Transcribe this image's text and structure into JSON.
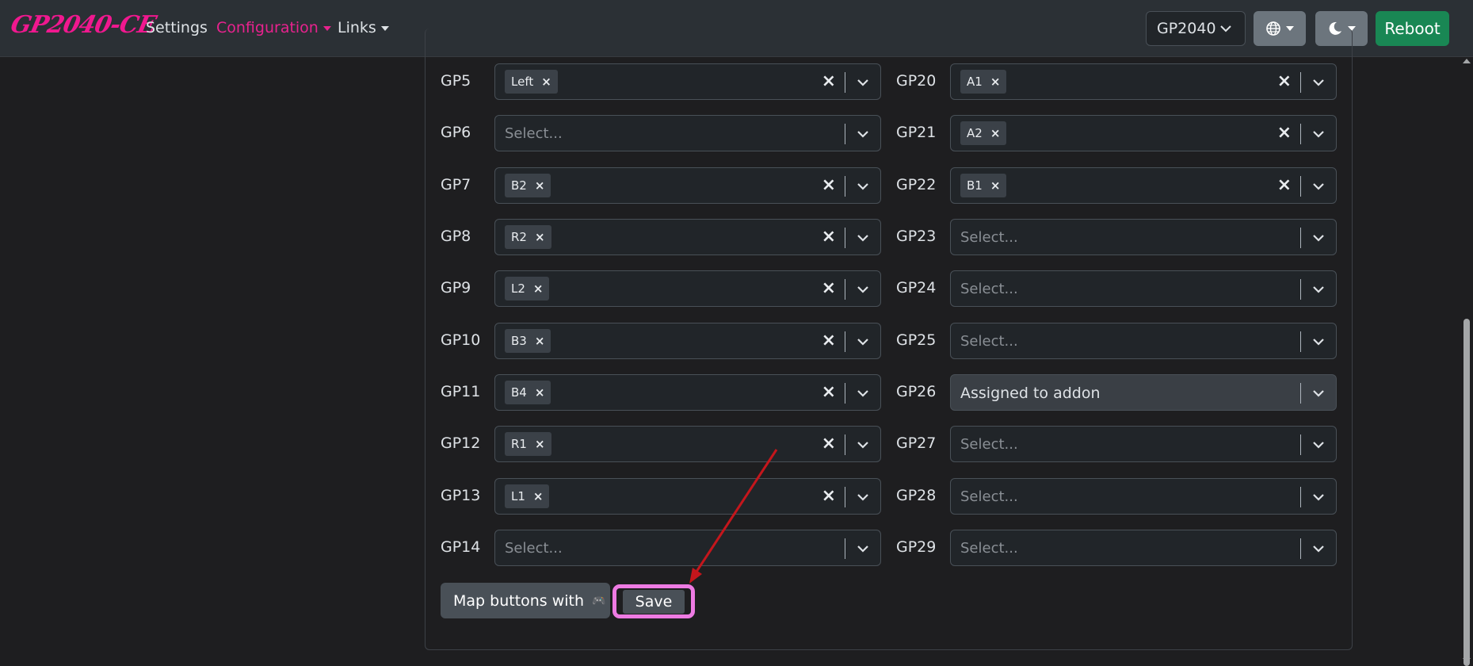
{
  "nav": {
    "brand": "GP2040-CE",
    "settings": "Settings",
    "configuration": "Configuration",
    "links": "Links",
    "board_select": "GP2040",
    "reboot": "Reboot",
    "language_icon": "globe-icon",
    "theme_icon": "moon-icon",
    "accent": "#e8228e"
  },
  "placeholder": "Select...",
  "left_rows": [
    {
      "pin": "GP5",
      "value": "Left"
    },
    {
      "pin": "GP6",
      "value": ""
    },
    {
      "pin": "GP7",
      "value": "B2"
    },
    {
      "pin": "GP8",
      "value": "R2"
    },
    {
      "pin": "GP9",
      "value": "L2"
    },
    {
      "pin": "GP10",
      "value": "B3"
    },
    {
      "pin": "GP11",
      "value": "B4"
    },
    {
      "pin": "GP12",
      "value": "R1"
    },
    {
      "pin": "GP13",
      "value": "L1"
    },
    {
      "pin": "GP14",
      "value": ""
    }
  ],
  "right_rows": [
    {
      "pin": "GP20",
      "value": "A1"
    },
    {
      "pin": "GP21",
      "value": "A2"
    },
    {
      "pin": "GP22",
      "value": "B1"
    },
    {
      "pin": "GP23",
      "value": ""
    },
    {
      "pin": "GP24",
      "value": ""
    },
    {
      "pin": "GP25",
      "value": ""
    },
    {
      "pin": "GP26",
      "value": "",
      "assigned": "Assigned to addon"
    },
    {
      "pin": "GP27",
      "value": ""
    },
    {
      "pin": "GP28",
      "value": ""
    },
    {
      "pin": "GP29",
      "value": ""
    }
  ],
  "actions": {
    "map_buttons": "Map buttons with",
    "map_icon": "gamepad-icon",
    "save": "Save"
  }
}
